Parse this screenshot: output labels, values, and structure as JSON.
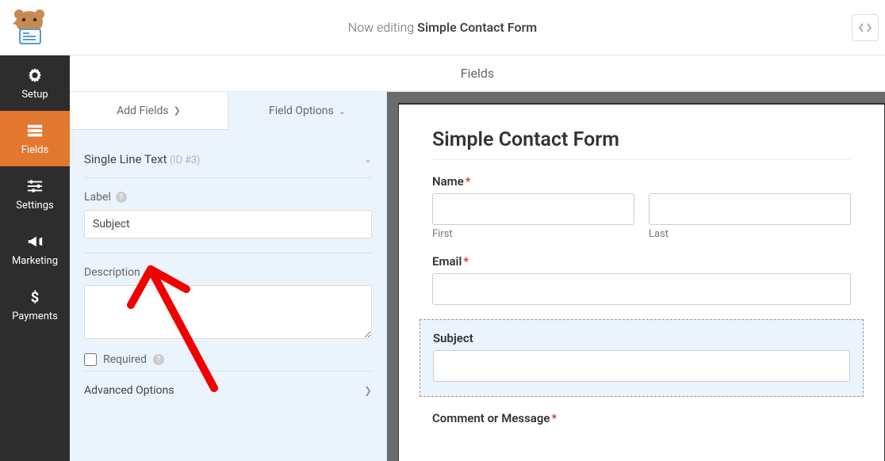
{
  "header": {
    "editing_prefix": "Now editing ",
    "form_name": "Simple Contact Form"
  },
  "sidebar": {
    "items": [
      {
        "label": "Setup",
        "icon": "gear"
      },
      {
        "label": "Fields",
        "icon": "form"
      },
      {
        "label": "Settings",
        "icon": "sliders"
      },
      {
        "label": "Marketing",
        "icon": "megaphone"
      },
      {
        "label": "Payments",
        "icon": "dollar"
      }
    ]
  },
  "content_header": "Fields",
  "panel": {
    "tabs": {
      "add": "Add Fields",
      "options": "Field Options"
    },
    "section": {
      "name": "Single Line Text",
      "id": "(ID #3)"
    },
    "label_title": "Label",
    "label_value": "Subject",
    "description_title": "Description",
    "description_value": "",
    "required_label": "Required",
    "advanced_label": "Advanced Options"
  },
  "preview": {
    "title": "Simple Contact Form",
    "name_label": "Name",
    "first_sub": "First",
    "last_sub": "Last",
    "email_label": "Email",
    "subject_label": "Subject",
    "comment_label": "Comment or Message"
  }
}
